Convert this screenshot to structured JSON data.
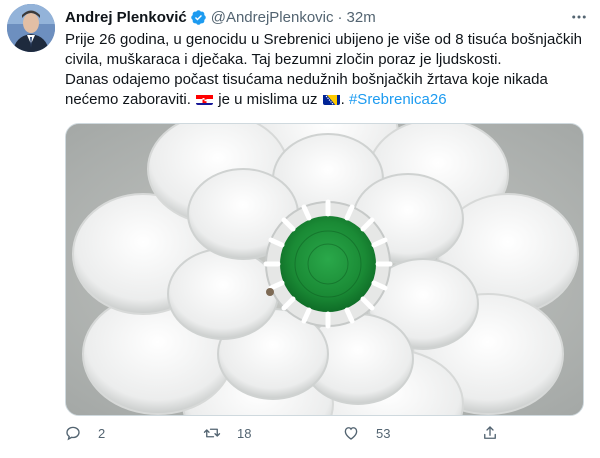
{
  "author": {
    "name": "Andrej Plenković",
    "handle": "@AndrejPlenkovic",
    "separator": "·",
    "time": "32m",
    "verified": true
  },
  "tweet": {
    "line1": "Prije 26 godina, u genocidu u Srebrenici ubijeno je više od 8 tisuća bošnjačkih civila, muškaraca i dječaka. Taj bezumni zločin poraz je ljudskosti.",
    "line2_part1": "Danas odajemo počast tisućama nedužnih bošnjačkih žrtava koje nikada nećemo zaboraviti.",
    "line2_part2": "je u mislima uz",
    "line2_part3": ".",
    "hashtag": "#Srebrenica26",
    "flag1": "flag-croatia",
    "flag2": "flag-bosnia-herzegovina"
  },
  "media": {
    "subject": "white-crocheted-flower-with-green-center"
  },
  "actions": {
    "reply_count": "2",
    "retweet_count": "18",
    "like_count": "53"
  },
  "colors": {
    "link": "#1d9bf0",
    "secondary_text": "#536471",
    "verified": "#1d9bf0"
  }
}
